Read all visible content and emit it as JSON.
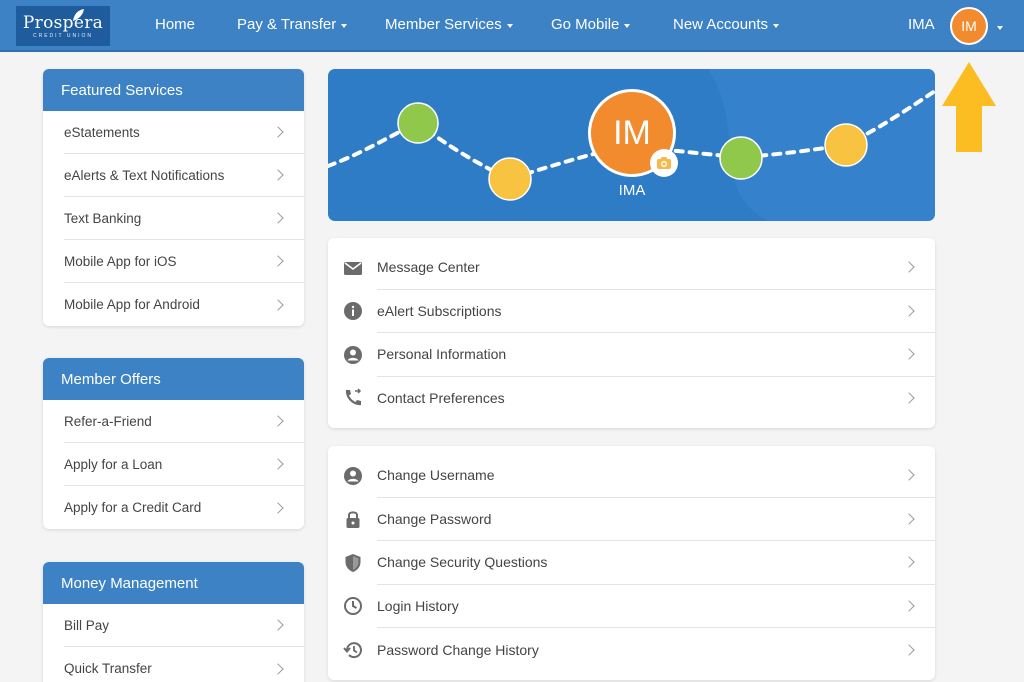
{
  "header": {
    "logo_text": "Prospera",
    "logo_sub": "CREDIT UNION",
    "nav": [
      {
        "label": "Home",
        "dropdown": false
      },
      {
        "label": "Pay & Transfer",
        "dropdown": true
      },
      {
        "label": "Member Services",
        "dropdown": true
      },
      {
        "label": "Go Mobile",
        "dropdown": true
      },
      {
        "label": "New Accounts",
        "dropdown": true
      }
    ],
    "user_name": "IMA",
    "avatar_initials": "IM"
  },
  "sidebar": {
    "featured": {
      "title": "Featured Services",
      "items": [
        "eStatements",
        "eAlerts & Text Notifications",
        "Text Banking",
        "Mobile App for iOS",
        "Mobile App for Android"
      ]
    },
    "offers": {
      "title": "Member Offers",
      "items": [
        "Refer-a-Friend",
        "Apply for a Loan",
        "Apply for a Credit Card"
      ]
    },
    "money": {
      "title": "Money Management",
      "items": [
        "Bill Pay",
        "Quick Transfer"
      ]
    }
  },
  "profile": {
    "initials": "IM",
    "name": "IMA"
  },
  "settings_primary": [
    {
      "label": "Message Center",
      "icon": "envelope-icon"
    },
    {
      "label": "eAlert Subscriptions",
      "icon": "info-icon"
    },
    {
      "label": "Personal Information",
      "icon": "user-circle-icon"
    },
    {
      "label": "Contact Preferences",
      "icon": "phone-forward-icon"
    }
  ],
  "settings_security": [
    {
      "label": "Change Username",
      "icon": "user-circle-icon"
    },
    {
      "label": "Change Password",
      "icon": "lock-icon"
    },
    {
      "label": "Change Security Questions",
      "icon": "shield-icon"
    },
    {
      "label": "Login History",
      "icon": "clock-icon"
    },
    {
      "label": "Password Change History",
      "icon": "history-icon"
    }
  ],
  "colors": {
    "nav_blue": "#3c82c4",
    "avatar_orange": "#f28a2e",
    "arrow_yellow": "#fbbd22",
    "dot_green": "#8fc84a",
    "dot_yellow": "#f7c341"
  }
}
